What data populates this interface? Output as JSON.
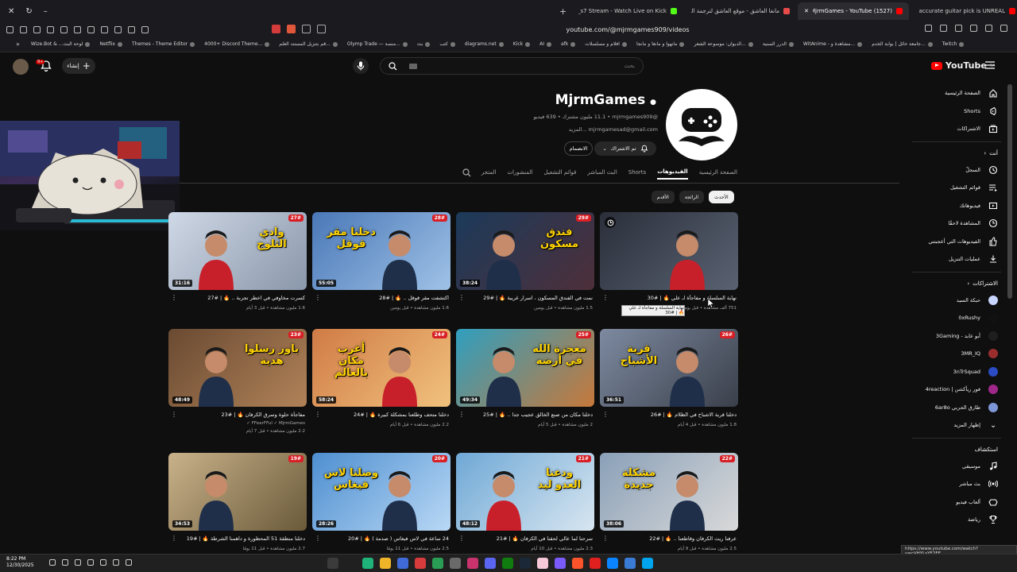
{
  "browser": {
    "tabs": [
      {
        "title": "rudio_s7 Stream - Watch Live on Kick",
        "active": false,
        "color": "#53fc18"
      },
      {
        "title": "مانغا العاشق - موقع العاشق لترجمة المانغا",
        "active": false,
        "color": "#e84a4a"
      },
      {
        "title": "(1527) MjrmGames - YouTube",
        "active": true,
        "color": "#ff0000"
      },
      {
        "title": "Biblically accurate guitar pick is UNREAL",
        "active": false,
        "color": "#ff0000"
      }
    ],
    "url": "youtube.com/@mjrmgames909/videos",
    "bookmarks": [
      "Wize.Bot & ...لوحة البث",
      "Netflix",
      "Themes - Theme Editor",
      "4000+ Discord Theme...",
      "قم بتنزيل المستند العلم...",
      "Olymp Trade — منصة...",
      "بث",
      "كتب",
      "diagrams.net",
      "Kick",
      "AI",
      "afk",
      "افلام و مسلسلات",
      "مانهوا و مانغا و مانجا",
      "الديوان: موسوعة الشعر...",
      "الدرر السنية",
      "WitAnime - مشاهدة و...",
      "جامعة حائل | بوابة الخدم...",
      "Twitch"
    ]
  },
  "masthead": {
    "notification_count": "9+",
    "create_label": "إنشاء",
    "search_placeholder": "بحث",
    "logo_text": "YouTube",
    "logo_country": "SA"
  },
  "sidebar": {
    "main": [
      {
        "label": "الصفحة الرئيسية",
        "icon": "home-icon"
      },
      {
        "label": "Shorts",
        "icon": "shorts-icon"
      },
      {
        "label": "الاشتراكات",
        "icon": "subscriptions-icon"
      }
    ],
    "you_header": "أنت",
    "you": [
      {
        "label": "السجلّ",
        "icon": "history-icon"
      },
      {
        "label": "قوائم التشغيل",
        "icon": "playlist-icon"
      },
      {
        "label": "فيديوهاتك",
        "icon": "your-videos-icon"
      },
      {
        "label": "المشاهدة لاحقًا",
        "icon": "watch-later-icon"
      },
      {
        "label": "الفيديوهات التي أعجبتني",
        "icon": "like-icon"
      },
      {
        "label": "عمليات التنزيل",
        "icon": "download-icon"
      }
    ],
    "subs_header": "الاشتراكات",
    "subs": [
      {
        "label": "حبكة السيد",
        "color": "#c9d6ff"
      },
      {
        "label": "0xRushy",
        "color": "#111111"
      },
      {
        "label": "أبو عابد - 3Gaming",
        "color": "#1e1e1e"
      },
      {
        "label": "3MR_IQ",
        "color": "#9b2d2d"
      },
      {
        "label": "3nTrSquad",
        "color": "#2b4cc4"
      },
      {
        "label": "فور ريأكشن | 4reaction",
        "color": "#a0278a"
      },
      {
        "label": "طارق الحربي 6ar8o",
        "color": "#7d96d6"
      }
    ],
    "show_more": "إظهار المزيد",
    "explore_header": "استكشاف",
    "explore": [
      {
        "label": "موسيقى",
        "icon": "music-icon"
      },
      {
        "label": "بث مباشر",
        "icon": "live-icon"
      },
      {
        "label": "ألعاب فيديو",
        "icon": "gaming-icon"
      },
      {
        "label": "رياضة",
        "icon": "trophy-icon"
      }
    ]
  },
  "channel": {
    "name": "MjrmGames",
    "handle_stats": "@mjrmgames909 • ‏11.1 مليون مشترك • ‏639 فيديو",
    "more": "mjrmgamesad@gmail.com ...المزيد",
    "subscribe_label": "تم الاشتراك",
    "join_label": "الانضمام",
    "tabs": [
      {
        "label": "الصفحة الرئيسية",
        "active": false
      },
      {
        "label": "الفيديوهات",
        "active": true
      },
      {
        "label": "Shorts",
        "active": false
      },
      {
        "label": "البث المباشر",
        "active": false
      },
      {
        "label": "قوائم التشغيل",
        "active": false
      },
      {
        "label": "المنشورات",
        "active": false
      },
      {
        "label": "المتجر",
        "active": false
      }
    ],
    "chips": [
      {
        "label": "الأحدث",
        "active": true
      },
      {
        "label": "الرائجة",
        "active": false
      },
      {
        "label": "الأقدم",
        "active": false
      }
    ]
  },
  "videos": [
    {
      "title": "نهاية السلسلة و مفاجأة لـ علي 🔥 | #30",
      "meta": "751 ألف مشاهدة • قبل يوم واحد",
      "meta2": "",
      "duration": "",
      "episode": "",
      "overlay": "",
      "c1": "#2a2f3a",
      "c2": "#5a6272"
    },
    {
      "title": "نمت في الفندق المسكون ، اسرار غريبة 🔥 | #29",
      "meta": "1.5 مليون مشاهدة • قبل يومين",
      "meta2": "",
      "duration": "38:24",
      "episode": "29#",
      "overlay": "فندق مسكون",
      "c1": "#1b3a5a",
      "c2": "#4e2f3a"
    },
    {
      "title": "اكتشفت مقر قوقل .. 🔥 | #28",
      "meta": "1.6 مليون مشاهدة • قبل يومين",
      "meta2": "",
      "duration": "55:05",
      "episode": "28#",
      "overlay": "دخلنا مقر قوقل",
      "c1": "#4a78b8",
      "c2": "#9fc2e6"
    },
    {
      "title": "كسرت مخاوفي في اخطر تجربة .. 🔥 | #27",
      "meta": "1.6 مليون مشاهدة • قبل 3 أيام",
      "meta2": "",
      "duration": "31:16",
      "episode": "27#",
      "overlay": "وادي الثلوج",
      "c1": "#cfd8e6",
      "c2": "#8a97aa"
    },
    {
      "title": "دخلنا قرية الاشباح في الظلام 🔥 | #26",
      "meta": "1.8 مليون مشاهدة • قبل 4 أيام",
      "meta2": "",
      "duration": "36:51",
      "episode": "26#",
      "overlay": "قرية الأشباح",
      "c1": "#7d8aa0",
      "c2": "#3a3f4a"
    },
    {
      "title": "دخلنا مكان من صنع الخالق عجيب جدا .. 🔥 | #25",
      "meta": "2 مليون مشاهدة • قبل 5 أيام",
      "meta2": "",
      "duration": "49:34",
      "episode": "25#",
      "overlay": "معجزة الله في أرضه",
      "c1": "#2f9fbf",
      "c2": "#c7783a"
    },
    {
      "title": "دخلنا متحف وطلعنا بمشكلة كبيرة 🔥 | #24",
      "meta": "2.2 مليون مشاهدة • قبل 6 أيام",
      "meta2": "",
      "duration": "58:24",
      "episode": "24#",
      "overlay": "أغرب مكان بالعالم",
      "c1": "#d07b46",
      "c2": "#f1c27d"
    },
    {
      "title": "مفاجأة حلوة وسرق الكرفان 🔥 | #23",
      "meta": "2.2 مليون مشاهدة • قبل 7 أيام",
      "meta2": "FFearFFul ✓ MjrmGames ✓",
      "duration": "48:49",
      "episode": "23#",
      "overlay": "باور رسلوا هدية",
      "c1": "#6a4a32",
      "c2": "#b08258"
    },
    {
      "title": "عرفنا ريت الكرفان وقاطعنا .. 🔥 | #22",
      "meta": "2.5 مليون مشاهدة • قبل 9 أيام",
      "meta2": "",
      "duration": "38:06",
      "episode": "22#",
      "overlay": "مشكلة جديدة",
      "c1": "#8aa0b8",
      "c2": "#d9d9d9"
    },
    {
      "title": "سرحنا لما عالي لحقنا في الكرفان 🔥 | #21",
      "meta": "2.3 مليون مشاهدة • قبل 10 أيام",
      "meta2": "",
      "duration": "48:12",
      "episode": "21#",
      "overlay": "ودعنا العدو ليد",
      "c1": "#6fa8d6",
      "c2": "#d8e6f0"
    },
    {
      "title": "24 ساعة في لاس فيغاس ( صدمة ) 🔥 | #20",
      "meta": "2.5 مليون مشاهدة • قبل 11 يومًا",
      "meta2": "",
      "duration": "28:26",
      "episode": "20#",
      "overlay": "وصلنا لاس فيغاس",
      "c1": "#4e8fd0",
      "c2": "#b9d8f5"
    },
    {
      "title": "دخلنا منطقة 51 المحظورة و داهمنا الشرطة 🔥 | #19",
      "meta": "2.7 مليون مشاهدة • قبل 11 يومًا",
      "meta2": "",
      "duration": "34:53",
      "episode": "19#",
      "overlay": "",
      "c1": "#c9b28a",
      "c2": "#6a5a3a"
    }
  ],
  "tooltip": "نهاية السلسلة و مفاجأة لـ علي 🔥 | #30",
  "status_url": "https://www.youtube.com/watch?v=cVHYLsYE2FE",
  "taskbar": {
    "time": "8:22 PM",
    "date": "12/30/2025"
  }
}
